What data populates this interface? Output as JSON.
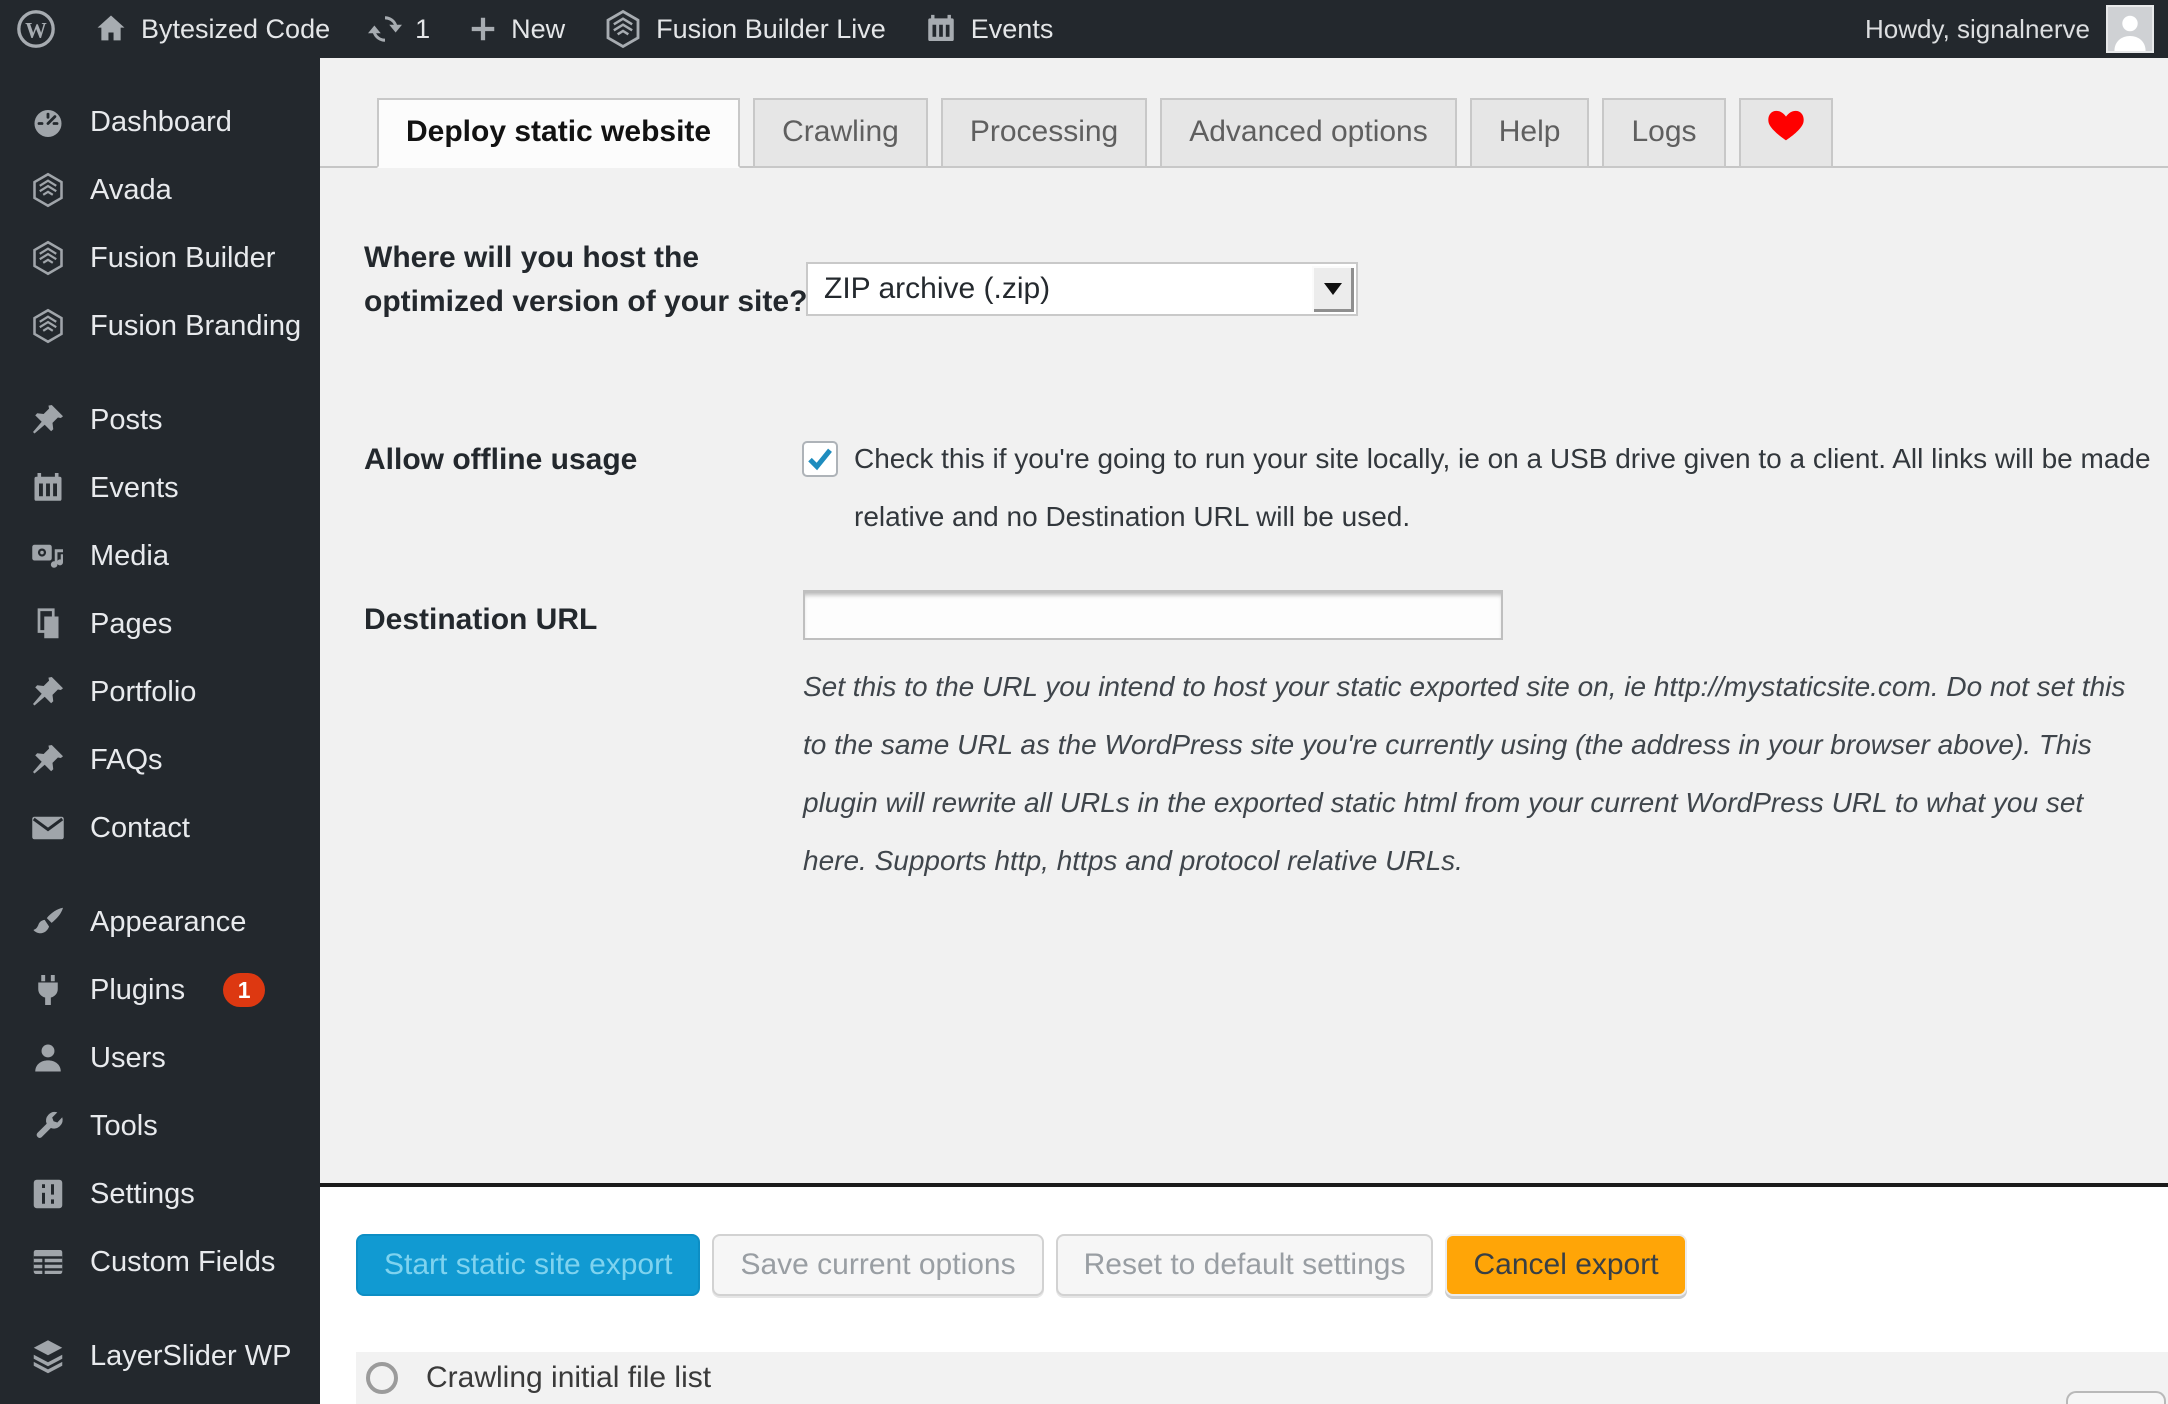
{
  "admin_bar": {
    "site_name": "Bytesized Code",
    "updates_count": "1",
    "new_label": "New",
    "fusion_builder_label": "Fusion Builder Live",
    "events_label": "Events",
    "howdy": "Howdy, signalnerve"
  },
  "sidebar": {
    "items": [
      {
        "label": "Dashboard",
        "icon": "dashboard-icon"
      },
      {
        "label": "Avada",
        "icon": "hexagon-icon"
      },
      {
        "label": "Fusion Builder",
        "icon": "hexagon-icon"
      },
      {
        "label": "Fusion Branding",
        "icon": "hexagon-icon"
      },
      {
        "label": "Posts",
        "icon": "pin-icon"
      },
      {
        "label": "Events",
        "icon": "calendar-icon"
      },
      {
        "label": "Media",
        "icon": "media-icon"
      },
      {
        "label": "Pages",
        "icon": "pages-icon"
      },
      {
        "label": "Portfolio",
        "icon": "pin-icon"
      },
      {
        "label": "FAQs",
        "icon": "pin-icon"
      },
      {
        "label": "Contact",
        "icon": "mail-icon"
      },
      {
        "label": "Appearance",
        "icon": "brush-icon"
      },
      {
        "label": "Plugins",
        "icon": "plugin-icon",
        "badge": "1"
      },
      {
        "label": "Users",
        "icon": "user-icon"
      },
      {
        "label": "Tools",
        "icon": "wrench-icon"
      },
      {
        "label": "Settings",
        "icon": "settings-icon"
      },
      {
        "label": "Custom Fields",
        "icon": "custom-fields-icon"
      },
      {
        "label": "LayerSlider WP",
        "icon": "layers-icon"
      }
    ]
  },
  "tabs": [
    {
      "label": "Deploy static website",
      "active": true
    },
    {
      "label": "Crawling"
    },
    {
      "label": "Processing"
    },
    {
      "label": "Advanced options"
    },
    {
      "label": "Help"
    },
    {
      "label": "Logs"
    },
    {
      "icon": "heart-icon"
    }
  ],
  "form": {
    "host_question": {
      "label": "Where will you host the optimized version of your site?",
      "selected_option": "ZIP archive (.zip)"
    },
    "offline": {
      "label": "Allow offline usage",
      "checked": true,
      "description": "Check this if you're going to run your site locally, ie on a USB drive given to a client. All links will be made relative and no Destination URL will be used."
    },
    "destination": {
      "label": "Destination URL",
      "value": "",
      "description": "Set this to the URL you intend to host your static exported site on, ie http://mystaticsite.com. Do not set this to the same URL as the WordPress site you're currently using (the address in your browser above). This plugin will rewrite all URLs in the exported static html from your current WordPress URL to what you set here. Supports http, https and protocol relative URLs."
    }
  },
  "actions": {
    "start": "Start static site export",
    "save": "Save current options",
    "reset": "Reset to default settings",
    "cancel": "Cancel export"
  },
  "status": {
    "label": "Crawling initial file list"
  },
  "icons": {
    "wordpress_logo": "circle-W",
    "home": "house",
    "updates": "refresh-arrows",
    "new": "plus",
    "fusion": "hexagon",
    "events": "calendar",
    "avatar": "person-silhouette",
    "heart_tab": "red-heart",
    "status_bullet": "empty-circle",
    "select_arrow": "down-triangle"
  },
  "colors": {
    "admin_bar_bg": "#23282d",
    "sidebar_bg": "#23282d",
    "content_bg": "#f1f1f1",
    "primary_button_bg": "#119ad2",
    "primary_button_text": "#7fd3ef",
    "cancel_button_bg": "#ffa507",
    "heart": "#ff0000",
    "badge_bg": "#dd3811",
    "checkbox_check": "#1e8cbe",
    "active_tab_bg": "#fcfcfc"
  }
}
